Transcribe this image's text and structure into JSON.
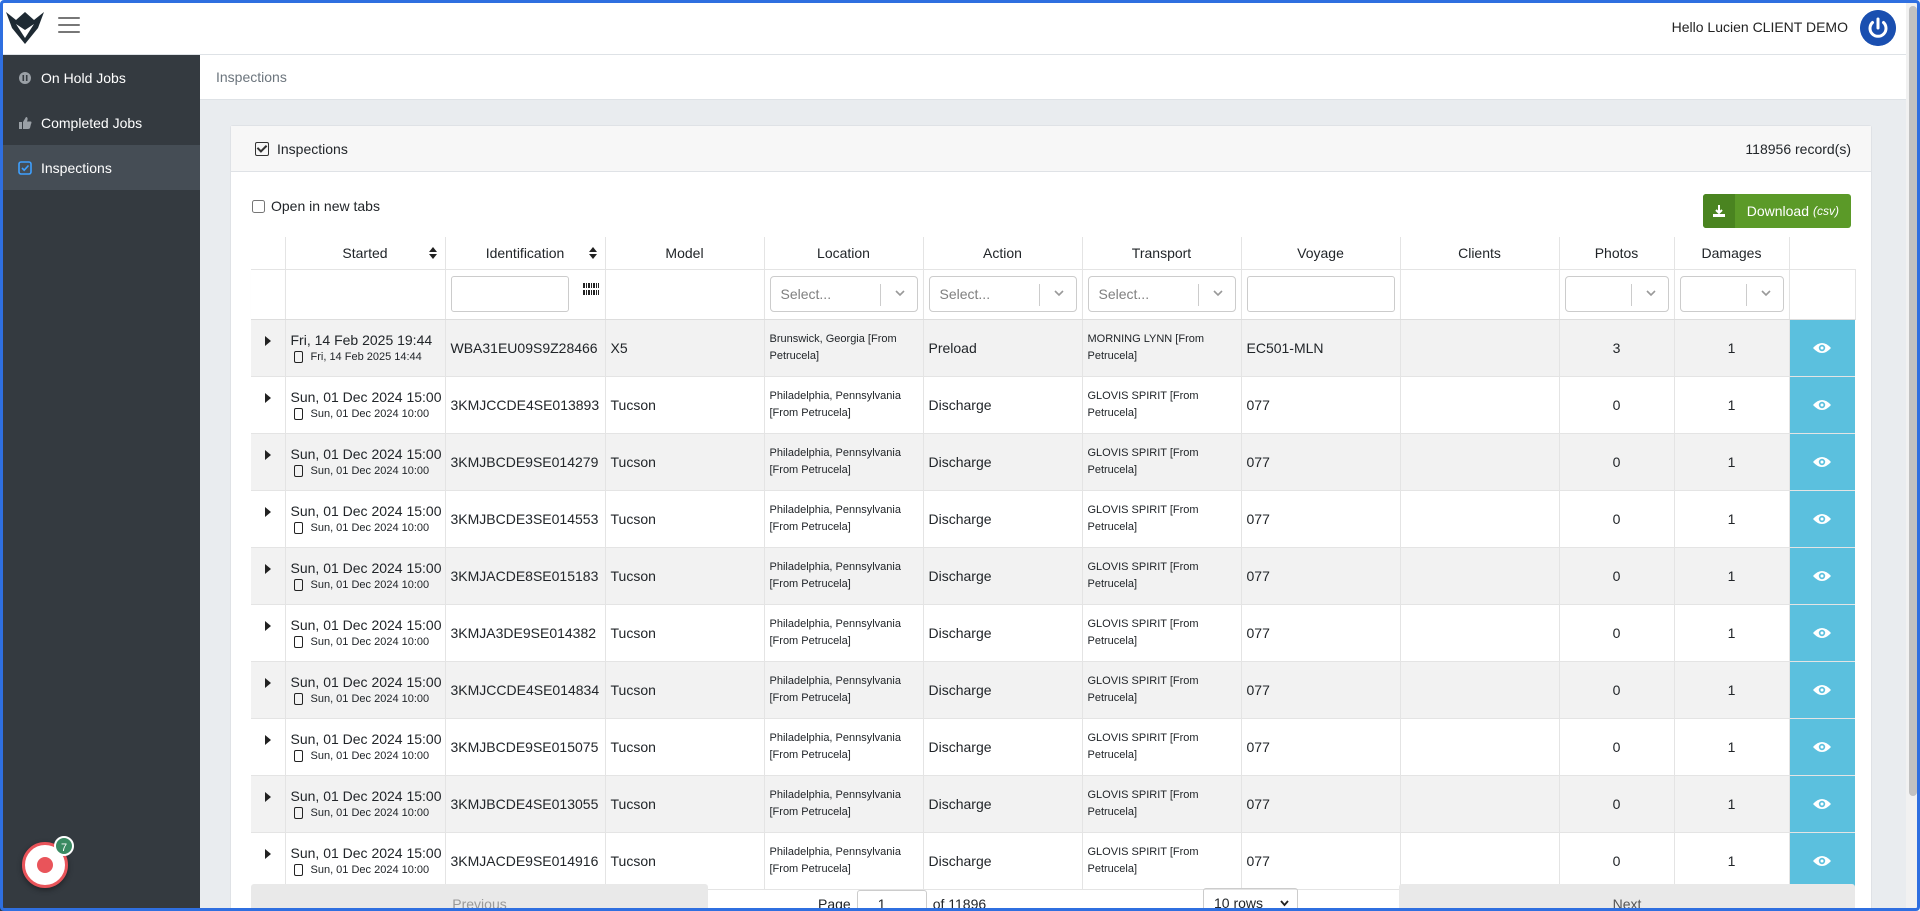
{
  "header": {
    "greeting": "Hello Lucien CLIENT DEMO"
  },
  "sidebar": {
    "items": [
      {
        "label": "On Hold Jobs",
        "icon": "pause-circle-icon"
      },
      {
        "label": "Completed Jobs",
        "icon": "thumbs-up-icon"
      },
      {
        "label": "Inspections",
        "icon": "checkbox-icon"
      }
    ],
    "active": "Inspections",
    "recorder_badge": "7"
  },
  "breadcrumb": "Inspections",
  "card": {
    "title": "Inspections",
    "records": "118956 record(s)",
    "open_new_tabs": "Open in new tabs",
    "download_label": "Download",
    "download_suffix": "(csv)"
  },
  "table": {
    "columns": [
      "Started",
      "Identification",
      "Model",
      "Location",
      "Action",
      "Transport",
      "Voyage",
      "Clients",
      "Photos",
      "Damages"
    ],
    "select_placeholder": "Select...",
    "rows": [
      {
        "started": "Fri, 14 Feb 2025 19:44",
        "device": "Fri, 14 Feb 2025 14:44",
        "id": "WBA31EU09S9Z28466",
        "model": "X5",
        "location": "Brunswick, Georgia [From Petrucela]",
        "action": "Preload",
        "transport": "MORNING LYNN [From Petrucela]",
        "voyage": "EC501-MLN",
        "clients": "",
        "photos": "3",
        "damages": "1"
      },
      {
        "started": "Sun, 01 Dec 2024 15:00",
        "device": "Sun, 01 Dec 2024 10:00",
        "id": "3KMJCCDE4SE013893",
        "model": "Tucson",
        "location": "Philadelphia, Pennsylvania [From Petrucela]",
        "action": "Discharge",
        "transport": "GLOVIS SPIRIT [From Petrucela]",
        "voyage": "077",
        "clients": "",
        "photos": "0",
        "damages": "1"
      },
      {
        "started": "Sun, 01 Dec 2024 15:00",
        "device": "Sun, 01 Dec 2024 10:00",
        "id": "3KMJBCDE9SE014279",
        "model": "Tucson",
        "location": "Philadelphia, Pennsylvania [From Petrucela]",
        "action": "Discharge",
        "transport": "GLOVIS SPIRIT [From Petrucela]",
        "voyage": "077",
        "clients": "",
        "photos": "0",
        "damages": "1"
      },
      {
        "started": "Sun, 01 Dec 2024 15:00",
        "device": "Sun, 01 Dec 2024 10:00",
        "id": "3KMJBCDE3SE014553",
        "model": "Tucson",
        "location": "Philadelphia, Pennsylvania [From Petrucela]",
        "action": "Discharge",
        "transport": "GLOVIS SPIRIT [From Petrucela]",
        "voyage": "077",
        "clients": "",
        "photos": "0",
        "damages": "1"
      },
      {
        "started": "Sun, 01 Dec 2024 15:00",
        "device": "Sun, 01 Dec 2024 10:00",
        "id": "3KMJACDE8SE015183",
        "model": "Tucson",
        "location": "Philadelphia, Pennsylvania [From Petrucela]",
        "action": "Discharge",
        "transport": "GLOVIS SPIRIT [From Petrucela]",
        "voyage": "077",
        "clients": "",
        "photos": "0",
        "damages": "1"
      },
      {
        "started": "Sun, 01 Dec 2024 15:00",
        "device": "Sun, 01 Dec 2024 10:00",
        "id": "3KMJA3DE9SE014382",
        "model": "Tucson",
        "location": "Philadelphia, Pennsylvania [From Petrucela]",
        "action": "Discharge",
        "transport": "GLOVIS SPIRIT [From Petrucela]",
        "voyage": "077",
        "clients": "",
        "photos": "0",
        "damages": "1"
      },
      {
        "started": "Sun, 01 Dec 2024 15:00",
        "device": "Sun, 01 Dec 2024 10:00",
        "id": "3KMJCCDE4SE014834",
        "model": "Tucson",
        "location": "Philadelphia, Pennsylvania [From Petrucela]",
        "action": "Discharge",
        "transport": "GLOVIS SPIRIT [From Petrucela]",
        "voyage": "077",
        "clients": "",
        "photos": "0",
        "damages": "1"
      },
      {
        "started": "Sun, 01 Dec 2024 15:00",
        "device": "Sun, 01 Dec 2024 10:00",
        "id": "3KMJBCDE9SE015075",
        "model": "Tucson",
        "location": "Philadelphia, Pennsylvania [From Petrucela]",
        "action": "Discharge",
        "transport": "GLOVIS SPIRIT [From Petrucela]",
        "voyage": "077",
        "clients": "",
        "photos": "0",
        "damages": "1"
      },
      {
        "started": "Sun, 01 Dec 2024 15:00",
        "device": "Sun, 01 Dec 2024 10:00",
        "id": "3KMJBCDE4SE013055",
        "model": "Tucson",
        "location": "Philadelphia, Pennsylvania [From Petrucela]",
        "action": "Discharge",
        "transport": "GLOVIS SPIRIT [From Petrucela]",
        "voyage": "077",
        "clients": "",
        "photos": "0",
        "damages": "1"
      },
      {
        "started": "Sun, 01 Dec 2024 15:00",
        "device": "Sun, 01 Dec 2024 10:00",
        "id": "3KMJACDE9SE014916",
        "model": "Tucson",
        "location": "Philadelphia, Pennsylvania [From Petrucela]",
        "action": "Discharge",
        "transport": "GLOVIS SPIRIT [From Petrucela]",
        "voyage": "077",
        "clients": "",
        "photos": "0",
        "damages": "1"
      }
    ]
  },
  "pagination": {
    "previous": "Previous",
    "page_label": "Page",
    "page_value": "1",
    "of_label": "of 11896",
    "rows_option": "10 rows",
    "next": "Next"
  },
  "colors": {
    "sidebar": "#343a40",
    "download": "#5b9a28",
    "view_button": "#5bc0de",
    "power": "#1a4fb0"
  }
}
